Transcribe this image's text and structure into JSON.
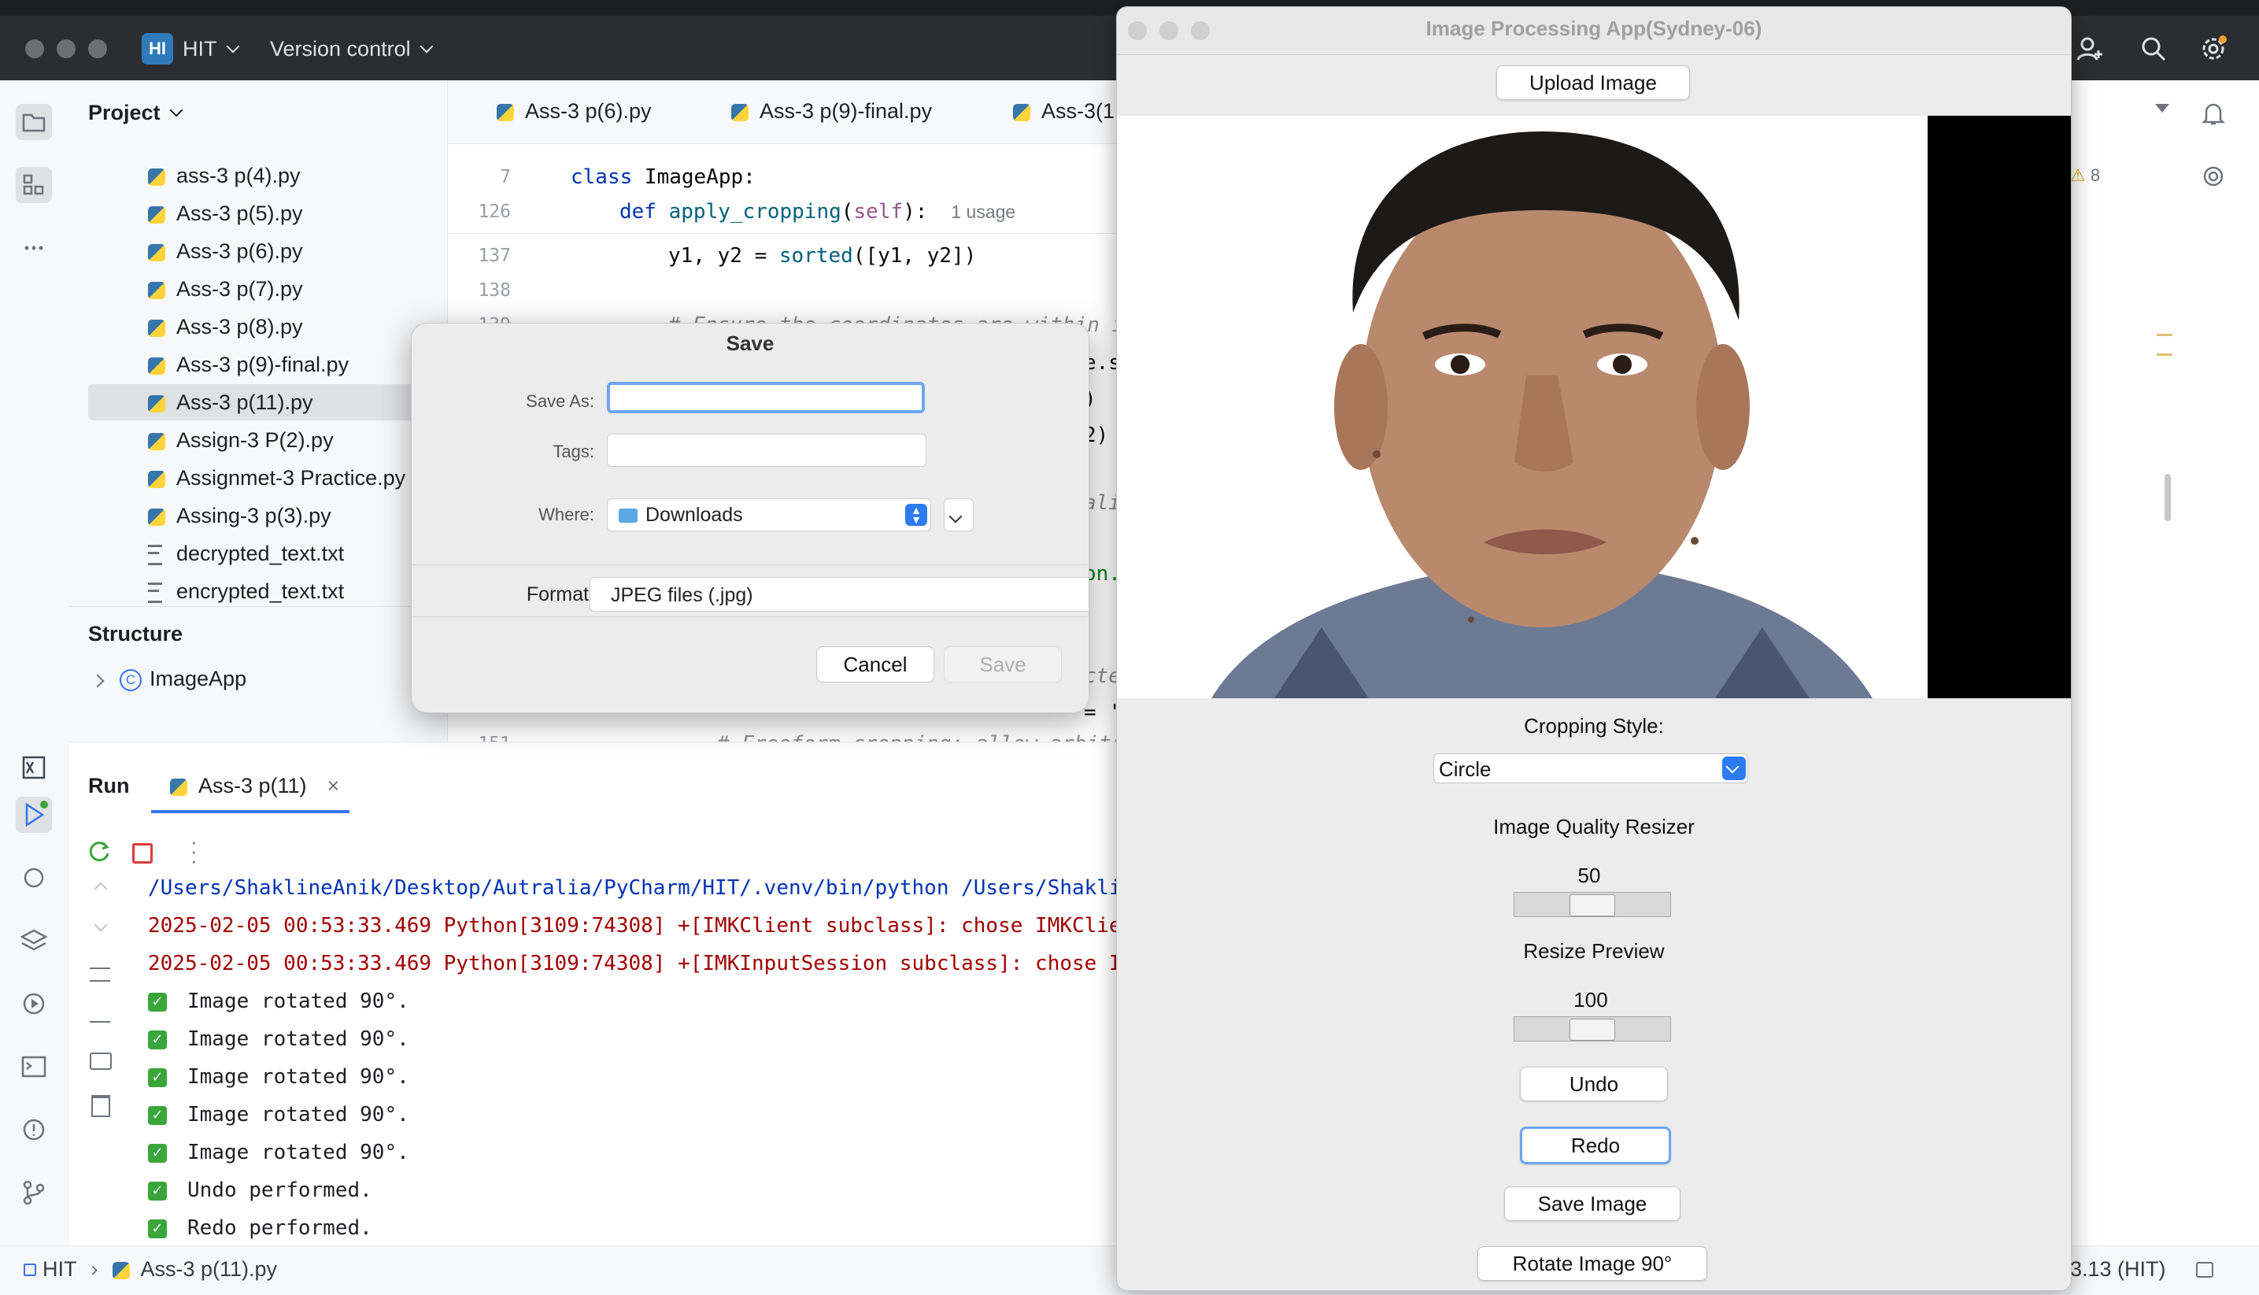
{
  "ide": {
    "project_badge": "HI",
    "project_name": "HIT",
    "vcs": "Version control",
    "project_panel_title": "Project",
    "files": [
      {
        "name": "ass-3 p(4).py",
        "type": "py"
      },
      {
        "name": "Ass-3 p(5).py",
        "type": "py"
      },
      {
        "name": "Ass-3 p(6).py",
        "type": "py"
      },
      {
        "name": "Ass-3 p(7).py",
        "type": "py"
      },
      {
        "name": "Ass-3 p(8).py",
        "type": "py"
      },
      {
        "name": "Ass-3 p(9)-final.py",
        "type": "py"
      },
      {
        "name": "Ass-3 p(11).py",
        "type": "py",
        "selected": true
      },
      {
        "name": "Assign-3 P(2).py",
        "type": "py"
      },
      {
        "name": "Assignmet-3 Practice.py",
        "type": "py"
      },
      {
        "name": "Assing-3 p(3).py",
        "type": "py"
      },
      {
        "name": "decrypted_text.txt",
        "type": "txt"
      },
      {
        "name": "encrypted_text.txt",
        "type": "txt"
      }
    ],
    "structure_title": "Structure",
    "structure_badge": "C",
    "structure_item": "ImageApp",
    "editor_tabs": [
      "Ass-3 p(6).py",
      "Ass-3 p(9)-final.py",
      "Ass-3(1"
    ],
    "code_lines": [
      {
        "num": "7",
        "text": "class ImageApp:"
      },
      {
        "num": "126",
        "text": "def apply_cropping(self):",
        "hint": "1 usage"
      },
      {
        "num": "137",
        "text": "y1, y2 = sorted([y1, y2])"
      },
      {
        "num": "138",
        "text": ""
      },
      {
        "num": "139",
        "text": "# Ensure the coordinates are within i"
      },
      {
        "num": "151",
        "text": "# Freeform cropping: allow arbitr"
      }
    ],
    "code_fragments": [
      "e.s",
      ")",
      "2)",
      "ali",
      "on.",
      "cte",
      "= '"
    ],
    "warnings_count": "8",
    "run_title": "Run",
    "run_tab": "Ass-3 p(11)",
    "console": [
      {
        "text": "/Users/ShaklineAnik/Desktop/Autralia/PyCharm/HIT/.venv/bin/python /Users/Shakli",
        "kind": "path"
      },
      {
        "text": "2025-02-05 00:53:33.469 Python[3109:74308] +[IMKClient subclass]: chose IMKClie",
        "kind": "error"
      },
      {
        "text": "2025-02-05 00:53:33.469 Python[3109:74308] +[IMKInputSession subclass]: chose I",
        "kind": "error"
      },
      {
        "text": "Image rotated 90°.",
        "kind": "ok"
      },
      {
        "text": "Image rotated 90°.",
        "kind": "ok"
      },
      {
        "text": "Image rotated 90°.",
        "kind": "ok"
      },
      {
        "text": "Image rotated 90°.",
        "kind": "ok"
      },
      {
        "text": "Image rotated 90°.",
        "kind": "ok"
      },
      {
        "text": "Undo performed.",
        "kind": "ok"
      },
      {
        "text": "Redo performed.",
        "kind": "ok"
      }
    ],
    "status_project": "HIT",
    "status_file": "Ass-3 p(11).py",
    "status_interpreter": "3.13 (HIT)"
  },
  "save_dialog": {
    "title": "Save",
    "save_as_label": "Save As:",
    "save_as_value": "",
    "tags_label": "Tags:",
    "where_label": "Where:",
    "where_value": "Downloads",
    "format_label": "Format:",
    "format_value": "JPEG files (.jpg)",
    "cancel": "Cancel",
    "save": "Save"
  },
  "image_app": {
    "title": "Image Processing App(Sydney-06)",
    "upload_button": "Upload Image",
    "cropping_label": "Cropping Style:",
    "cropping_value": "Circle",
    "quality_label": "Image Quality Resizer",
    "quality_value": "50",
    "resize_label": "Resize Preview",
    "resize_value": "100",
    "undo_button": "Undo",
    "redo_button": "Redo",
    "save_button": "Save Image",
    "rotate_button": "Rotate Image 90°"
  }
}
